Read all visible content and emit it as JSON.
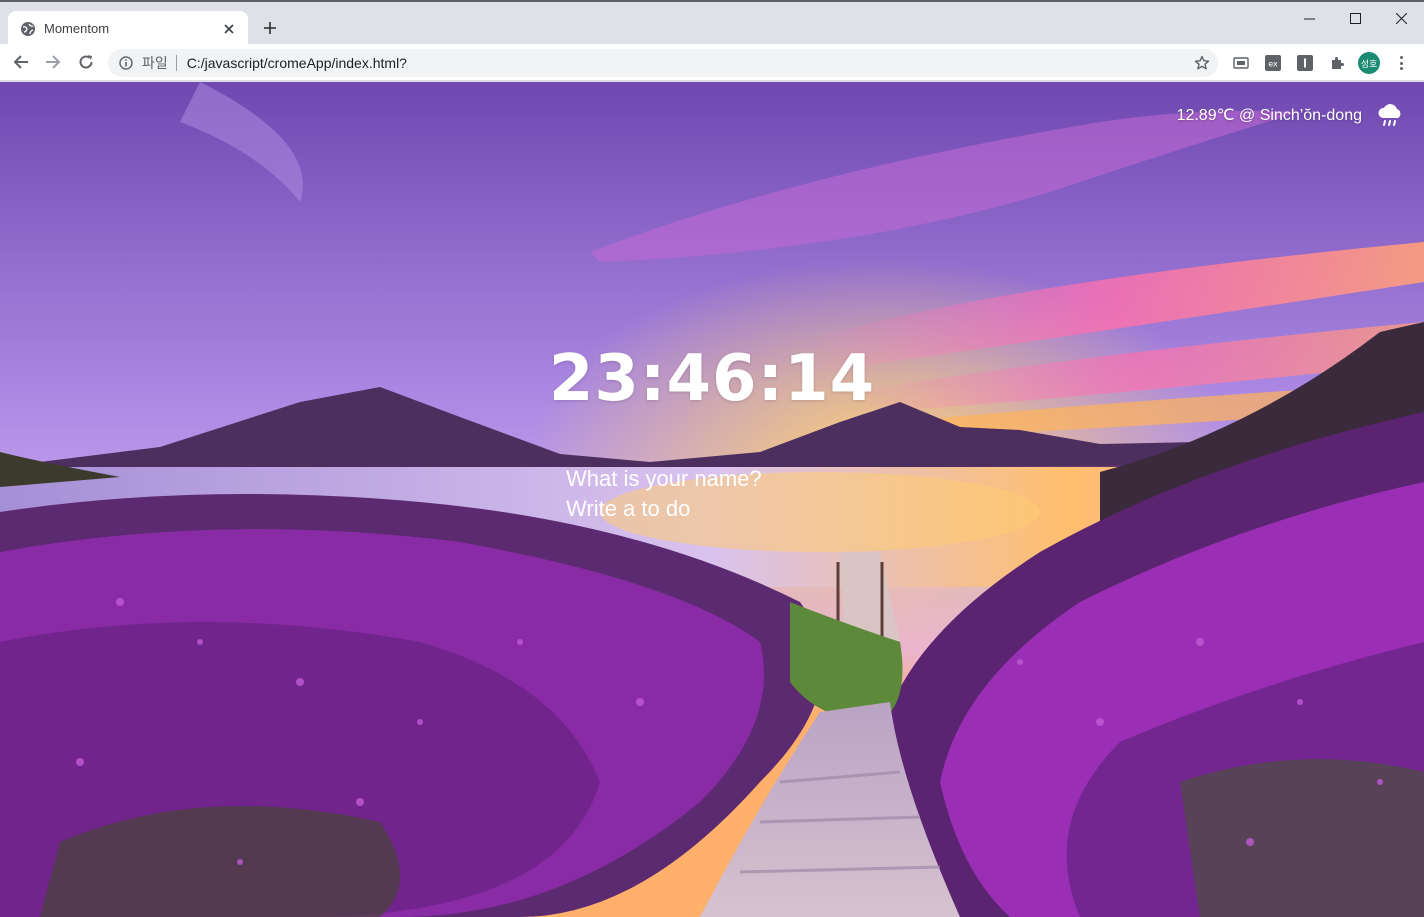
{
  "browser": {
    "tab_title": "Momentom",
    "scheme_label": "파일",
    "url": "C:/javascript/cromeApp/index.html?",
    "avatar_text": "성호",
    "icons": {
      "tab_favicon": "globe-icon",
      "tab_close": "close-icon",
      "new_tab": "plus-icon",
      "back": "arrow-left-icon",
      "forward": "arrow-right-icon",
      "reload": "reload-icon",
      "site_info": "info-icon",
      "bookmark": "star-icon",
      "extensions": "puzzle-icon",
      "menu": "more-vert-icon"
    }
  },
  "page": {
    "weather_text": "12.89℃ @ Sinch’ŏn-dong",
    "weather_icon": "cloud-rain-icon",
    "clock": "23:46:14",
    "name_prompt": "What is your name?",
    "todo_prompt": "Write a to do"
  },
  "colors": {
    "sky_top": "#7a4fb8",
    "sky_mid": "#b38ee8",
    "sunset": "#ff9a3c",
    "lake": "#c9a7e0",
    "lavender": "#8c2a9e",
    "foliage": "#3c5a2a",
    "avatar_bg": "#1a8a73"
  }
}
